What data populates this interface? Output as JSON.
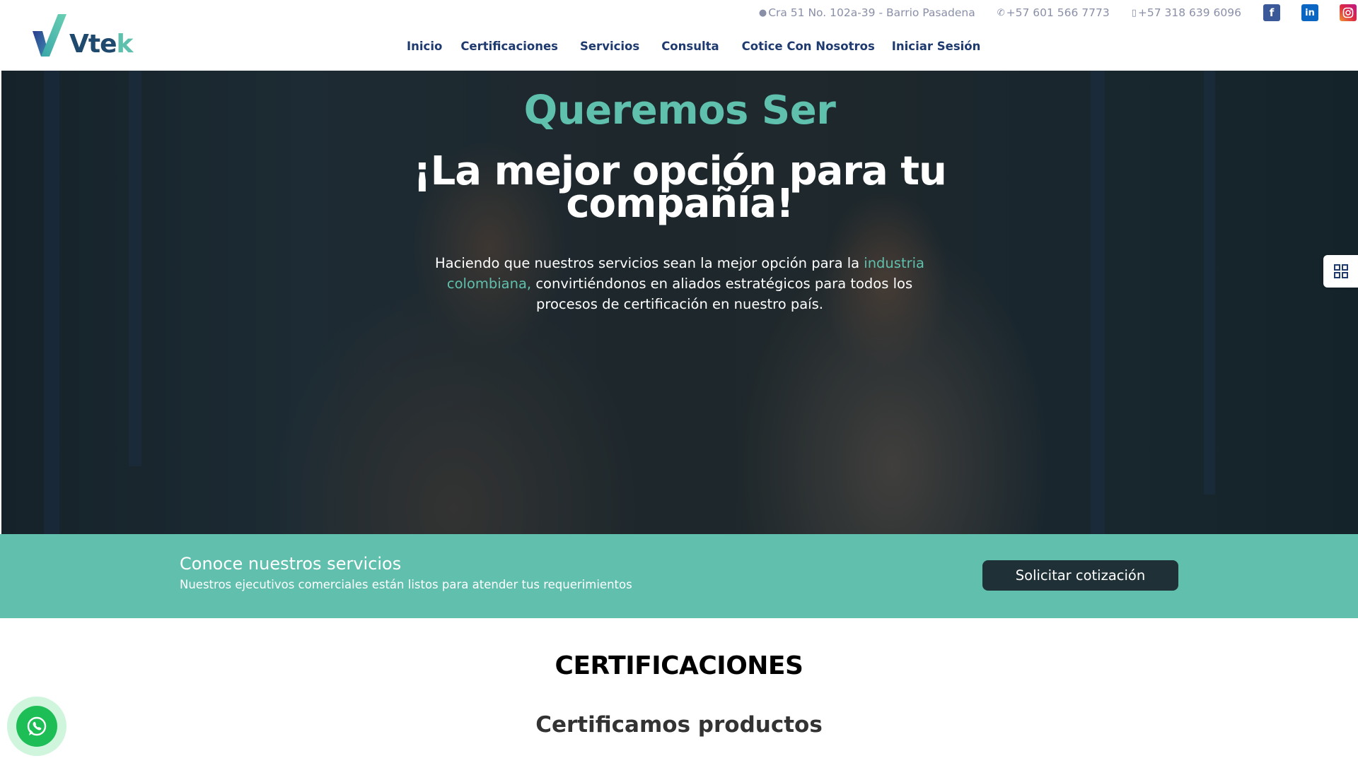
{
  "brand": {
    "name_main": "Vte",
    "name_accent": "k",
    "primary_color": "#1e3a6e",
    "accent_color": "#5fc0ad"
  },
  "topbar": {
    "address": "Cra 51 No. 102a-39 - Barrio Pasadena",
    "address_icon": "map-pin-icon",
    "phone": "+57 601 566 7773",
    "phone_icon": "phone-icon",
    "mobile": "+57 318 639 6096",
    "mobile_icon": "mobile-icon",
    "social": [
      {
        "name": "facebook",
        "glyph": "f",
        "icon": "facebook-icon"
      },
      {
        "name": "linkedin",
        "glyph": "in",
        "icon": "linkedin-icon"
      },
      {
        "name": "instagram",
        "glyph": "",
        "icon": "instagram-icon"
      }
    ]
  },
  "nav": {
    "items": [
      {
        "label": "Inicio"
      },
      {
        "label": "Certificaciones"
      },
      {
        "label": "Servicios"
      },
      {
        "label": "Consulta"
      },
      {
        "label": "Cotice Con Nosotros"
      },
      {
        "label": "Iniciar Sesión"
      }
    ]
  },
  "hero": {
    "title": "Queremos Ser",
    "subtitle": "¡La mejor opción para tu compañía!",
    "text_before": "Haciendo que nuestros servicios sean la mejor opción para la ",
    "text_highlight": "industria colombiana,",
    "text_after": " convirtiéndonos en aliados estratégicos para todos los procesos de certificación en nuestro país."
  },
  "side_tab": {
    "icon": "grid-icon"
  },
  "cta": {
    "title": "Conoce nuestros servicios",
    "subtitle": "Nuestros ejecutivos comerciales están listos para atender tus requerimientos",
    "button": "Solicitar cotización",
    "background": "#61bfad",
    "button_color": "#1f3137"
  },
  "certificaciones": {
    "title": "CERTIFICACIONES",
    "subtitle": "Certificamos productos"
  },
  "whatsapp": {
    "icon": "whatsapp-icon",
    "color": "#1ebe57"
  }
}
